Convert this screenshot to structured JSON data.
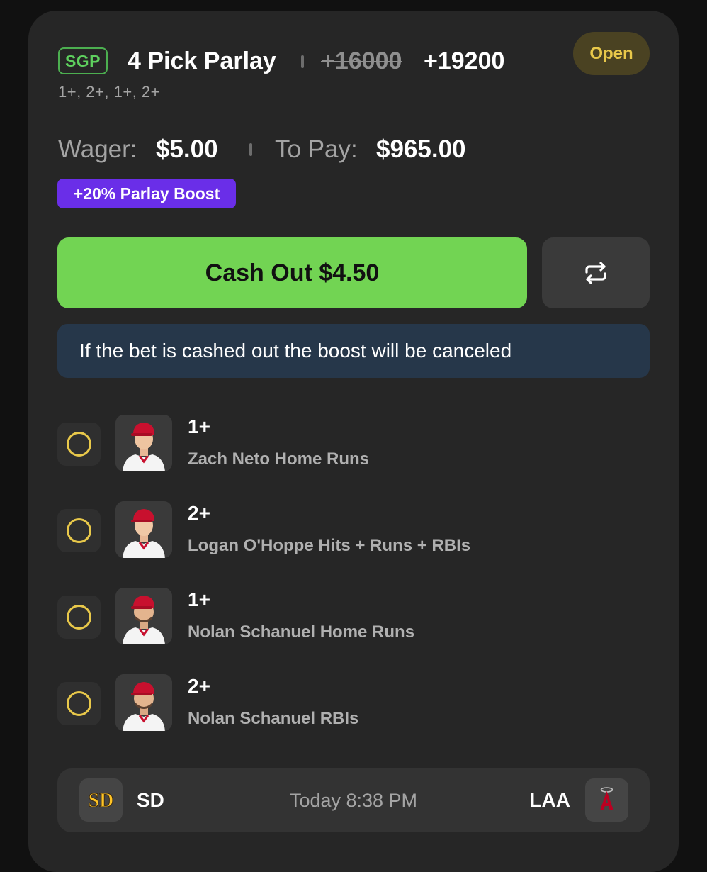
{
  "bet": {
    "type_badge": "SGP",
    "title": "4 Pick Parlay",
    "original_odds": "+16000",
    "boosted_odds": "+19200",
    "status": "Open",
    "subtitle": "1+, 2+, 1+, 2+",
    "wager_label": "Wager:",
    "wager_value": "$5.00",
    "to_pay_label": "To Pay:",
    "to_pay_value": "$965.00",
    "boost_badge": "+20% Parlay Boost"
  },
  "actions": {
    "cash_out_label": "Cash Out $4.50",
    "swap_icon": "repeat-icon"
  },
  "notice": {
    "text": "If the bet is cashed out the boost will be canceled"
  },
  "legs": [
    {
      "line": "1+",
      "description": "Zach Neto Home Runs",
      "status_icon": "pending-circle-icon",
      "avatar": "player-headshot"
    },
    {
      "line": "2+",
      "description": "Logan O'Hoppe Hits + Runs + RBIs",
      "status_icon": "pending-circle-icon",
      "avatar": "player-headshot"
    },
    {
      "line": "1+",
      "description": "Nolan Schanuel Home Runs",
      "status_icon": "pending-circle-icon",
      "avatar": "player-headshot"
    },
    {
      "line": "2+",
      "description": "Nolan Schanuel RBIs",
      "status_icon": "pending-circle-icon",
      "avatar": "player-headshot"
    }
  ],
  "game": {
    "away_team": "SD",
    "away_logo": "padres-logo-icon",
    "time": "Today 8:38 PM",
    "home_team": "LAA",
    "home_logo": "angels-logo-icon"
  },
  "colors": {
    "background": "#111111",
    "card": "#262626",
    "accent_green": "#72d453",
    "boost_purple": "#6a2ee8",
    "open_yellow": "#e8c84a",
    "notice_blue": "#26374a"
  }
}
